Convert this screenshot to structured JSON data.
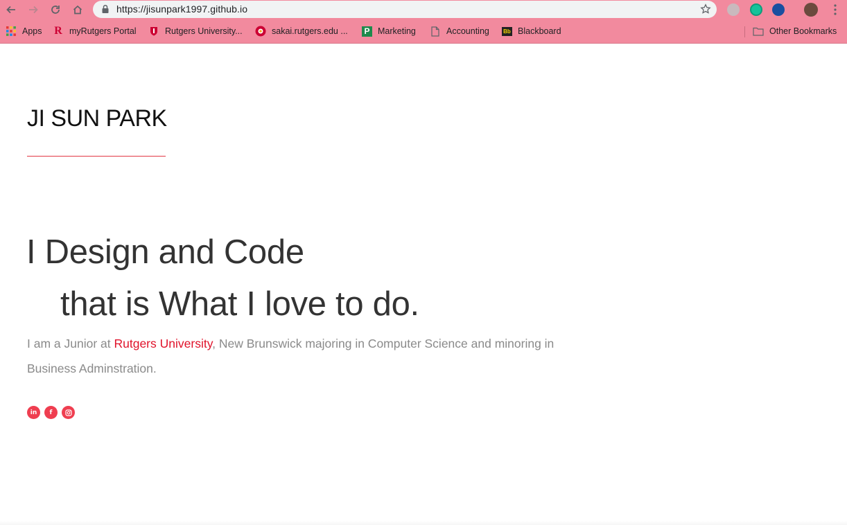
{
  "browser": {
    "url": "https://jisunpark1997.github.io",
    "bookmarks": [
      {
        "label": "Apps",
        "icon": "apps-grid-icon"
      },
      {
        "label": "myRutgers Portal",
        "icon": "rutgers-r-icon"
      },
      {
        "label": "Rutgers University...",
        "icon": "rutgers-shield-icon"
      },
      {
        "label": "sakai.rutgers.edu ...",
        "icon": "sakai-icon"
      },
      {
        "label": "Marketing",
        "icon": "marketing-p-icon"
      },
      {
        "label": "Accounting",
        "icon": "document-icon"
      },
      {
        "label": "Blackboard",
        "icon": "blackboard-icon"
      }
    ],
    "other_bookmarks": "Other Bookmarks",
    "colors": {
      "chrome_bg": "#f28a9e",
      "accent": "#e0122a"
    }
  },
  "site": {
    "name": "JI SUN PARK",
    "headline_line1": "I Design and Code",
    "headline_line2": "that is What I love to do.",
    "bio_before": "I am a Junior at ",
    "bio_link": "Rutgers University",
    "bio_after": ", New Brunswick majoring in Computer Science and minoring in Business Adminstration.",
    "social": [
      {
        "label": "in",
        "icon": "linkedin-icon"
      },
      {
        "label": "f",
        "icon": "facebook-icon"
      },
      {
        "label": "",
        "icon": "instagram-icon"
      }
    ]
  }
}
